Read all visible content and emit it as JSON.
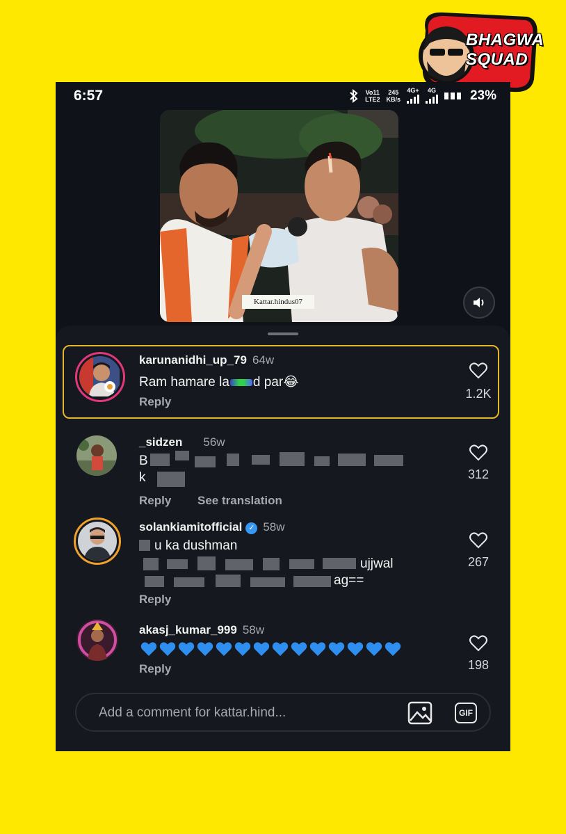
{
  "brand": {
    "line1": "BHAGWA",
    "line2": "SQUAD"
  },
  "status_bar": {
    "time": "6:57",
    "volte": "Vo11",
    "lte": "LTE2",
    "speed_value": "245",
    "speed_unit": "KB/s",
    "net1": "4G+",
    "net2": "4G",
    "battery": "23%"
  },
  "video": {
    "watermark": "Kattar.hindus07"
  },
  "comments": [
    {
      "username": "karunanidhi_up_79",
      "age": "64w",
      "text_a": "Ram hamare la",
      "text_b": "d par😂",
      "reply": "Reply",
      "likes": "1.2K"
    },
    {
      "username": "_sidzen",
      "age": "56w",
      "text_a": "B",
      "text_b": "k",
      "reply": "Reply",
      "translate": "See translation",
      "likes": "312"
    },
    {
      "username": "solankiamitofficial",
      "age": "58w",
      "text_a": "u ka dushman",
      "text_b": "ujjwal",
      "text_c": "ag==",
      "reply": "Reply",
      "likes": "267"
    },
    {
      "username": "akasj_kumar_999",
      "age": "58w",
      "reply": "Reply",
      "likes": "198",
      "blue_heart_count": 14
    }
  ],
  "composer": {
    "placeholder": "Add a comment for kattar.hind...",
    "gif": "GIF"
  }
}
